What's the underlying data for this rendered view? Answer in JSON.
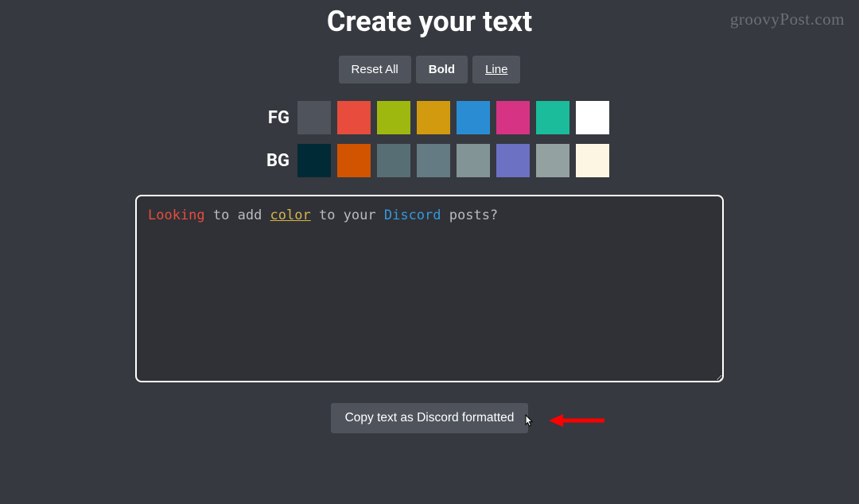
{
  "watermark": "groovyPost.com",
  "title": "Create your text",
  "toolbar": {
    "reset_label": "Reset All",
    "bold_label": "Bold",
    "line_label": "Line"
  },
  "palette": {
    "fg_label": "FG",
    "bg_label": "BG",
    "fg_colors": [
      "#4f545c",
      "#e74c3c",
      "#9fb80f",
      "#d19a0f",
      "#2a8dd4",
      "#d63384",
      "#1abc9c",
      "#ffffff"
    ],
    "bg_colors": [
      "#002b36",
      "#d35400",
      "#586e75",
      "#657b83",
      "#839496",
      "#6c71c4",
      "#93a1a1",
      "#fdf6e3"
    ]
  },
  "editor": {
    "segments": [
      {
        "text": "Looking",
        "class": "word-red"
      },
      {
        "text": " to add ",
        "class": "word-grey"
      },
      {
        "text": "color",
        "class": "word-color"
      },
      {
        "text": " to your ",
        "class": "word-grey"
      },
      {
        "text": "Discord",
        "class": "word-blue"
      },
      {
        "text": " posts?",
        "class": "word-grey"
      }
    ]
  },
  "copy_button_label": "Copy text as Discord formatted"
}
